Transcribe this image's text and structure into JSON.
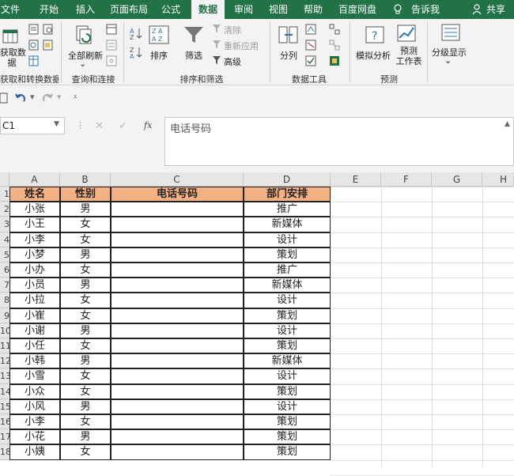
{
  "tabs": [
    "文件",
    "开始",
    "插入",
    "页面布局",
    "公式",
    "数据",
    "审阅",
    "视图",
    "帮助",
    "百度网盘",
    "告诉我",
    "共享"
  ],
  "active_tab": "数据",
  "ribbon": {
    "get_data": "获取数据",
    "get_data_l1": "获取数",
    "get_data_l2": "据",
    "refresh_all": "全部刷新",
    "sort": "排序",
    "filter": "筛选",
    "clear": "清除",
    "reapply": "重新应用",
    "advanced": "高级",
    "split": "分列",
    "whatif": "模拟分析",
    "forecast_l1": "预测",
    "forecast_l2": "工作表",
    "outline": "分级显示",
    "groups": [
      "获取和转换数据",
      "查询和连接",
      "排序和筛选",
      "数据工具",
      "预测"
    ]
  },
  "namebox": "C1",
  "formula": "电话号码",
  "columns": [
    "A",
    "B",
    "C",
    "D",
    "E",
    "F",
    "G",
    "H"
  ],
  "headers": [
    "姓名",
    "性别",
    "电话号码",
    "部门安排"
  ],
  "rows": [
    {
      "num": "2",
      "name": "小张",
      "sex": "男",
      "phone": "",
      "dept": "推广"
    },
    {
      "num": "3",
      "name": "小王",
      "sex": "女",
      "phone": "",
      "dept": "新媒体"
    },
    {
      "num": "4",
      "name": "小李",
      "sex": "女",
      "phone": "",
      "dept": "设计"
    },
    {
      "num": "5",
      "name": "小梦",
      "sex": "男",
      "phone": "",
      "dept": "策划"
    },
    {
      "num": "6",
      "name": "小办",
      "sex": "女",
      "phone": "",
      "dept": "推广"
    },
    {
      "num": "7",
      "name": "小员",
      "sex": "男",
      "phone": "",
      "dept": "新媒体"
    },
    {
      "num": "8",
      "name": "小拉",
      "sex": "女",
      "phone": "",
      "dept": "设计"
    },
    {
      "num": "9",
      "name": "小崔",
      "sex": "女",
      "phone": "",
      "dept": "策划"
    },
    {
      "num": "10",
      "name": "小谢",
      "sex": "男",
      "phone": "",
      "dept": "设计"
    },
    {
      "num": "11",
      "name": "小任",
      "sex": "女",
      "phone": "",
      "dept": "策划"
    },
    {
      "num": "12",
      "name": "小韩",
      "sex": "男",
      "phone": "",
      "dept": "新媒体"
    },
    {
      "num": "13",
      "name": "小雪",
      "sex": "女",
      "phone": "",
      "dept": "设计"
    },
    {
      "num": "14",
      "name": "小众",
      "sex": "女",
      "phone": "",
      "dept": "策划"
    },
    {
      "num": "15",
      "name": "小风",
      "sex": "男",
      "phone": "",
      "dept": "设计"
    },
    {
      "num": "16",
      "name": "小李",
      "sex": "女",
      "phone": "",
      "dept": "策划"
    },
    {
      "num": "17",
      "name": "小花",
      "sex": "男",
      "phone": "",
      "dept": "策划"
    },
    {
      "num": "18",
      "name": "小姨",
      "sex": "女",
      "phone": "",
      "dept": "策划"
    }
  ],
  "colors": {
    "accent": "#217346",
    "header_fill": "#f4b183"
  }
}
